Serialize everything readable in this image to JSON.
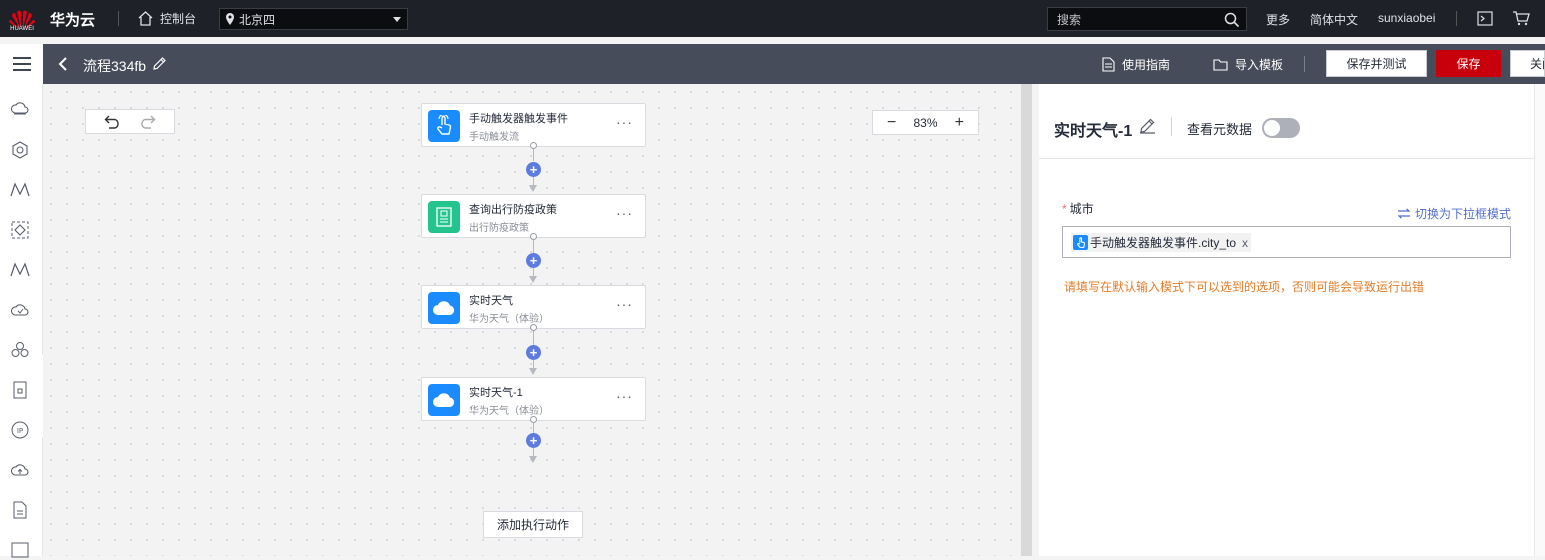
{
  "topbar": {
    "logo_text": "HUAWEI",
    "brand": "华为云",
    "console": "控制台",
    "region": "北京四",
    "search_placeholder": "搜索",
    "more": "更多",
    "language": "简体中文",
    "username": "sunxiaobei"
  },
  "subbar": {
    "flow_title": "流程334fb",
    "guide": "使用指南",
    "import_template": "导入模板",
    "save_and_test": "保存并测试",
    "save": "保存",
    "close": "关闭"
  },
  "leftbar": {
    "icons": [
      "cloud-server-icon",
      "hexagon-service-icon",
      "workflow-icon",
      "diamond-node-icon",
      "workflow-alt-icon",
      "cloud-check-icon",
      "cluster-icon",
      "document-lock-icon",
      "ip-icon",
      "cloud-upload-icon",
      "file-icon",
      "api-icon"
    ]
  },
  "canvas": {
    "zoom": "83%",
    "nodes": [
      {
        "title": "手动触发器触发事件",
        "subtitle": "手动触发流",
        "icon": "hand-touch-icon",
        "color": "#1a8cff"
      },
      {
        "title": "查询出行防疫政策",
        "subtitle": "出行防疫政策",
        "icon": "policy-doc-icon",
        "color": "#24c48e"
      },
      {
        "title": "实时天气",
        "subtitle": "华为天气（体验）",
        "icon": "cloud-icon",
        "color": "#1a8cff"
      },
      {
        "title": "实时天气-1",
        "subtitle": "华为天气（体验）",
        "icon": "cloud-icon",
        "color": "#1a8cff"
      }
    ],
    "add_action": "添加执行动作",
    "more_glyph": "···"
  },
  "panel": {
    "title": "实时天气-1",
    "view_metadata": "查看元数据",
    "view_metadata_on": false,
    "field_label": "城市",
    "required_mark": "*",
    "switch_mode": "切换为下拉框模式",
    "chip_text": "手动触发器触发事件.city_to",
    "chip_remove": "x",
    "warning": "请填写在默认输入模式下可以选到的选项，否则可能会导致运行出错"
  },
  "colors": {
    "topbar": "#1e2127",
    "subbar": "#464c59",
    "save_red": "#c7000b",
    "link_blue": "#526ecc",
    "plus_blue": "#5e7ce0",
    "warning_orange": "#e37d29"
  }
}
